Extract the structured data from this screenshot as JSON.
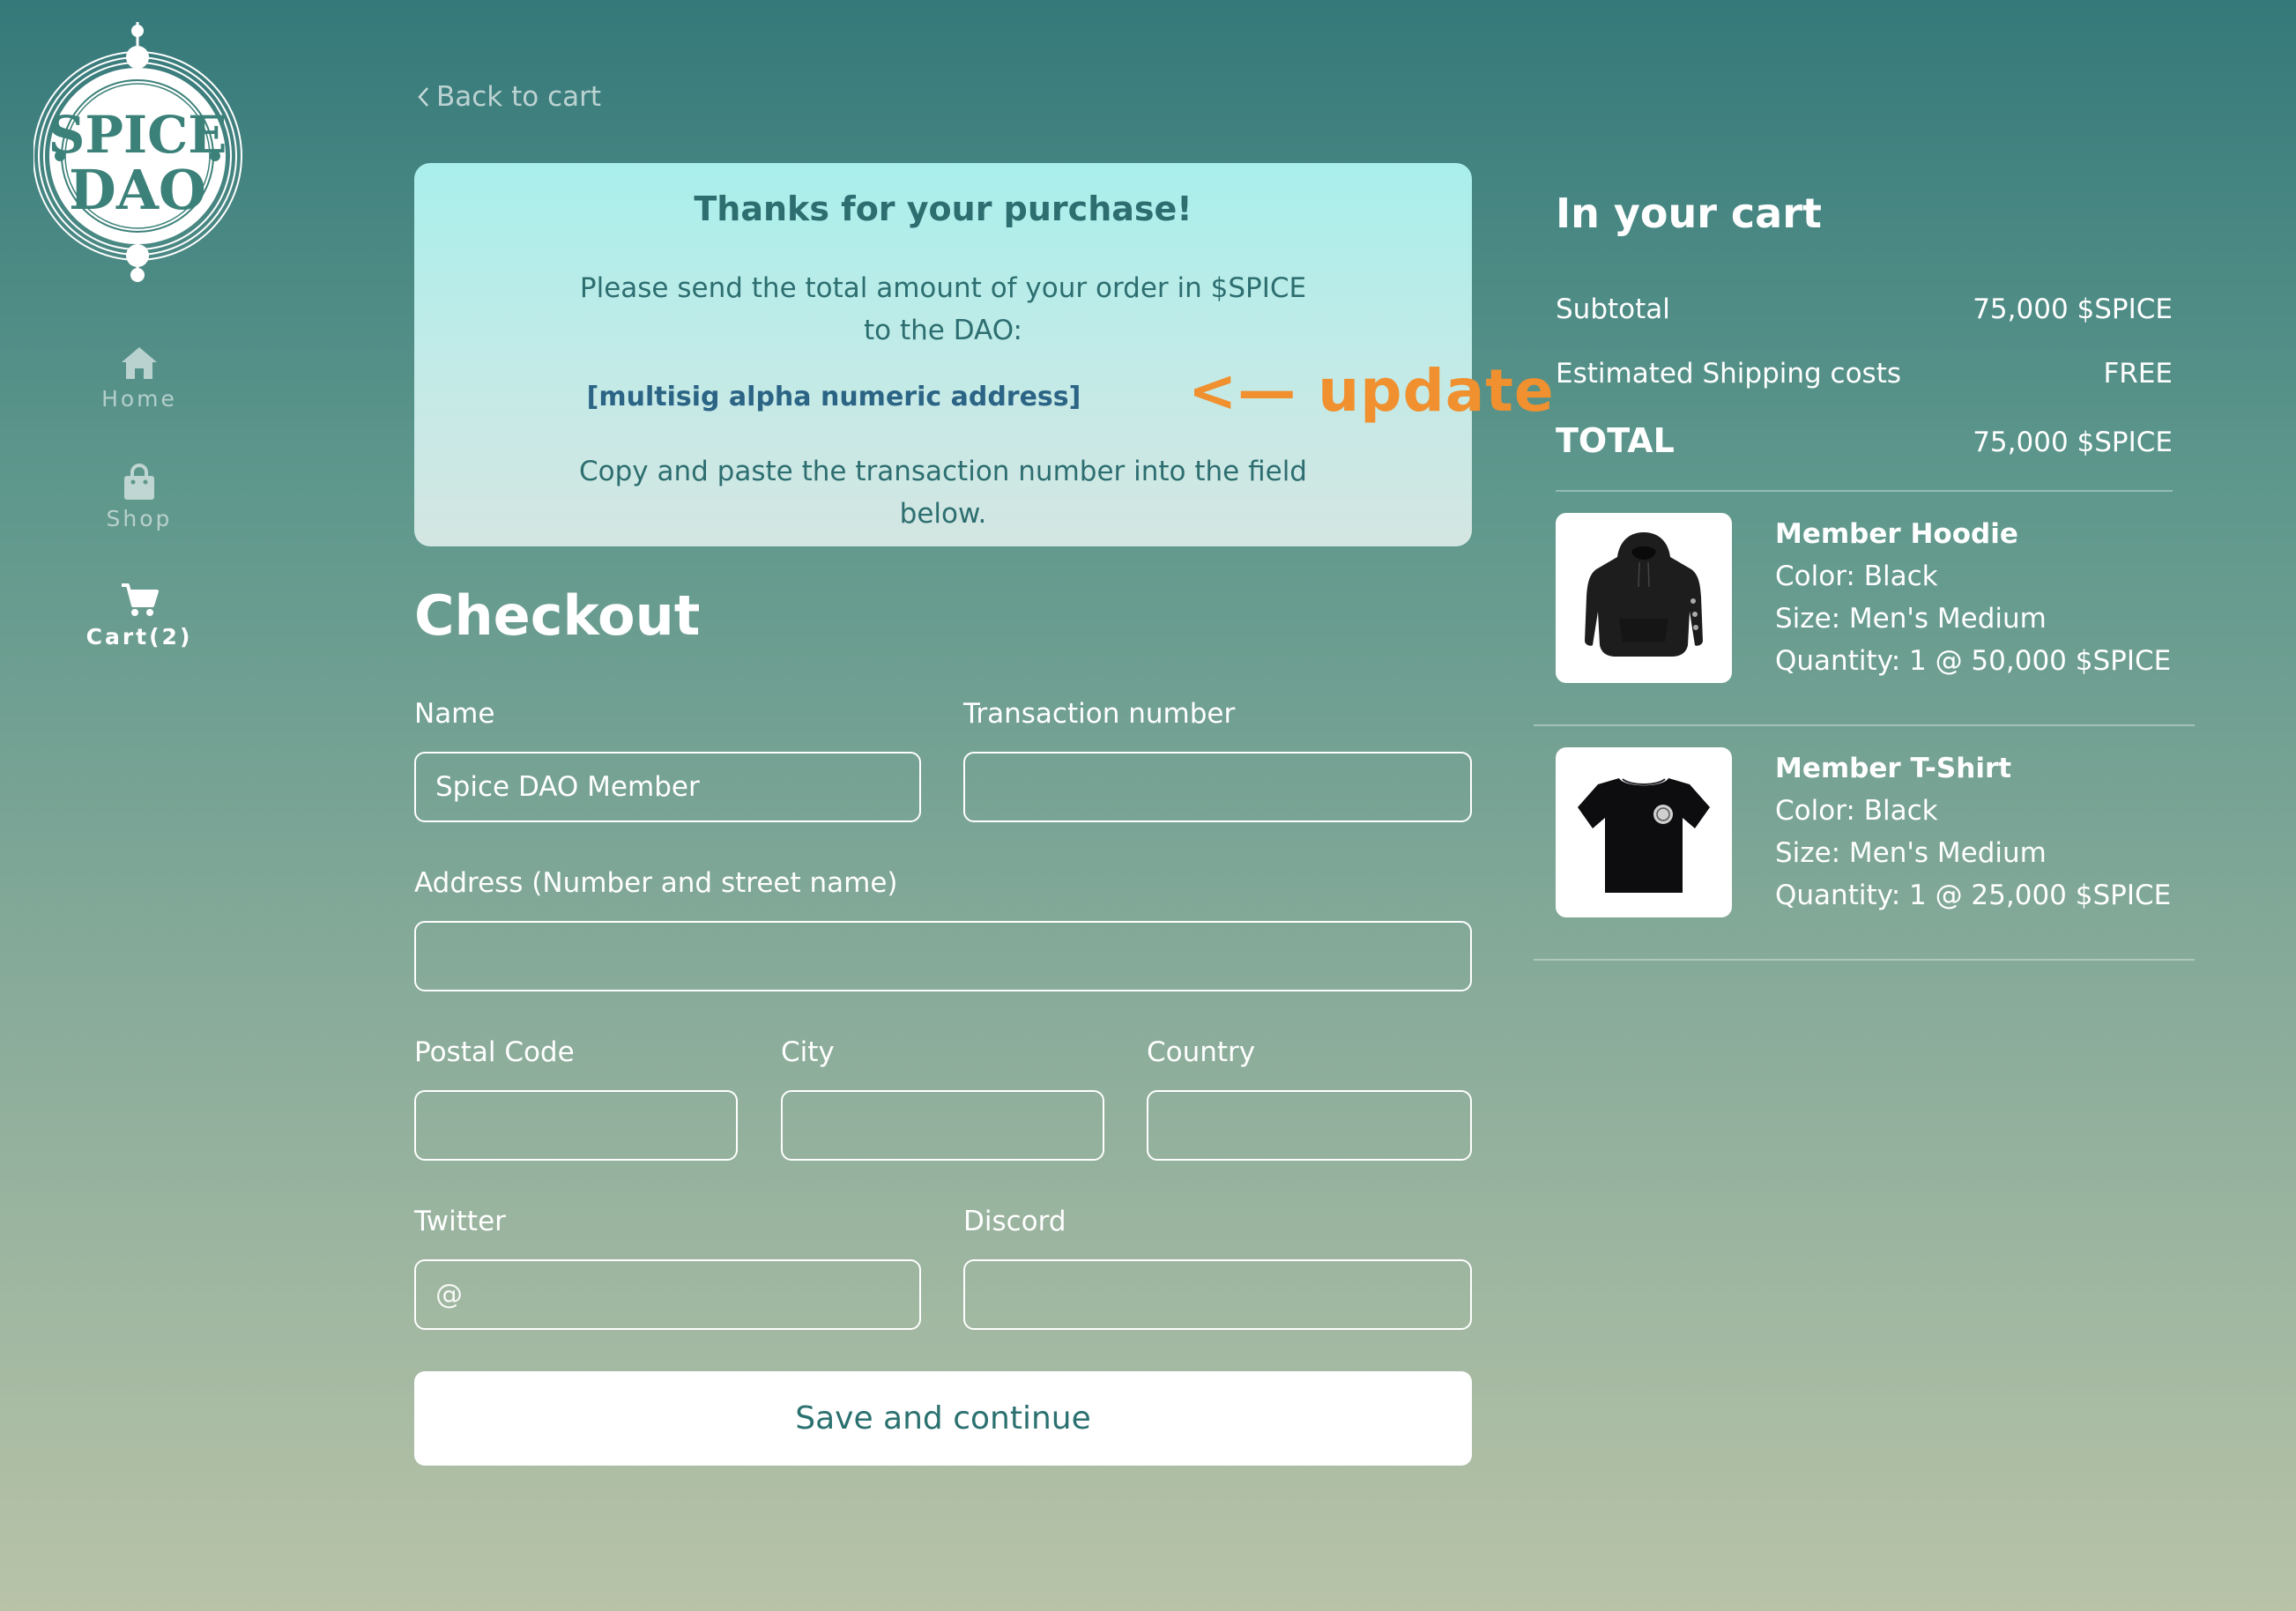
{
  "sidebar": {
    "nav": [
      {
        "label": "Home",
        "icon": "home-icon"
      },
      {
        "label": "Shop",
        "icon": "shopping-bag-icon"
      },
      {
        "label": "Cart(2)",
        "icon": "cart-icon"
      }
    ]
  },
  "back_link": "Back to cart",
  "notice": {
    "title": "Thanks for your purchase!",
    "send_line1": "Please send the total amount of your order in $SPICE",
    "send_line2": "to the DAO:",
    "address": "[multisig alpha numeric address]",
    "copy_line1": "Copy and paste the transaction number into the field",
    "copy_line2": "below.",
    "annotation": "<— update"
  },
  "checkout": {
    "title": "Checkout",
    "name_label": "Name",
    "name_value": "Spice DAO Member",
    "tx_label": "Transaction number",
    "address_label": "Address (Number and street name)",
    "postal_label": "Postal Code",
    "city_label": "City",
    "country_label": "Country",
    "twitter_label": "Twitter",
    "twitter_placeholder": "@",
    "discord_label": "Discord",
    "save_button": "Save and continue"
  },
  "cart": {
    "title": "In your cart",
    "subtotal_label": "Subtotal",
    "subtotal_value": "75,000 $SPICE",
    "shipping_label": "Estimated Shipping costs",
    "shipping_value": "FREE",
    "total_label": "TOTAL",
    "total_value": "75,000 $SPICE",
    "items": [
      {
        "name": "Member Hoodie",
        "color": "Color: Black",
        "size": "Size: Men's Medium",
        "quantity": "Quantity: 1 @ 50,000 $SPICE"
      },
      {
        "name": "Member T-Shirt",
        "color": "Color: Black",
        "size": "Size: Men's Medium",
        "quantity": "Quantity: 1 @ 25,000 $SPICE"
      }
    ]
  },
  "colors": {
    "accent": "#f0902f",
    "notice_text": "#2d6e70",
    "address_text": "#2b6485",
    "button_text": "#2b7170"
  }
}
